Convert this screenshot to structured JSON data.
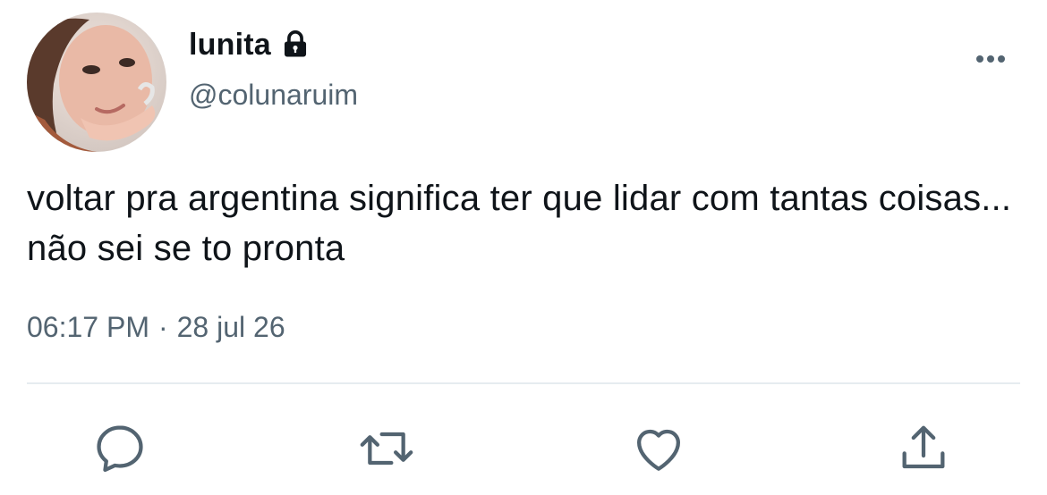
{
  "tweet": {
    "author": {
      "display_name": "lunita",
      "handle": "@colunaruim",
      "protected_icon": "lock-icon",
      "avatar": "profile-photo"
    },
    "text": "voltar pra argentina significa ter que lidar com tantas coisas... não sei se to pronta",
    "time": "06:17 PM",
    "separator": "·",
    "date": "28 jul 26",
    "more_icon": "more-options-icon"
  },
  "actions": [
    {
      "icon": "reply-icon"
    },
    {
      "icon": "retweet-icon"
    },
    {
      "icon": "like-icon"
    },
    {
      "icon": "share-icon"
    }
  ],
  "colors": {
    "text_primary": "#0f1419",
    "text_secondary": "#536471",
    "icon": "#536471",
    "divider": "#e6ecf0"
  }
}
